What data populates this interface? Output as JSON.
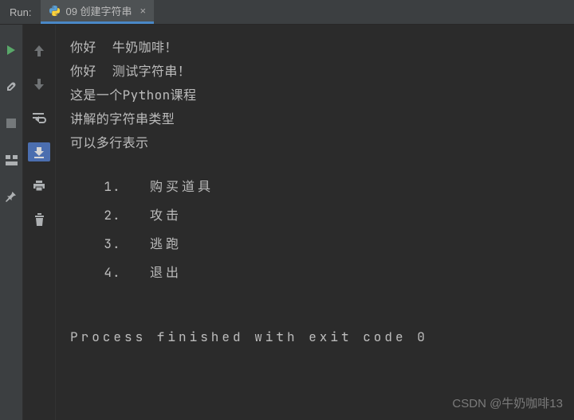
{
  "header": {
    "run_label": "Run:",
    "tab_filename": "09 创建字符串",
    "tab_close": "×"
  },
  "output": {
    "lines": [
      "你好  牛奶咖啡！",
      "你好  测试字符串！",
      "这是一个Python课程",
      "讲解的字符串类型",
      "可以多行表示"
    ],
    "menu": [
      {
        "num": "1．",
        "label": "购买道具"
      },
      {
        "num": "2．",
        "label": "攻击"
      },
      {
        "num": "3．",
        "label": "逃跑"
      },
      {
        "num": "4．",
        "label": "退出"
      }
    ],
    "exit_message": "Process finished with exit code 0"
  },
  "watermark": "CSDN @牛奶咖啡13"
}
